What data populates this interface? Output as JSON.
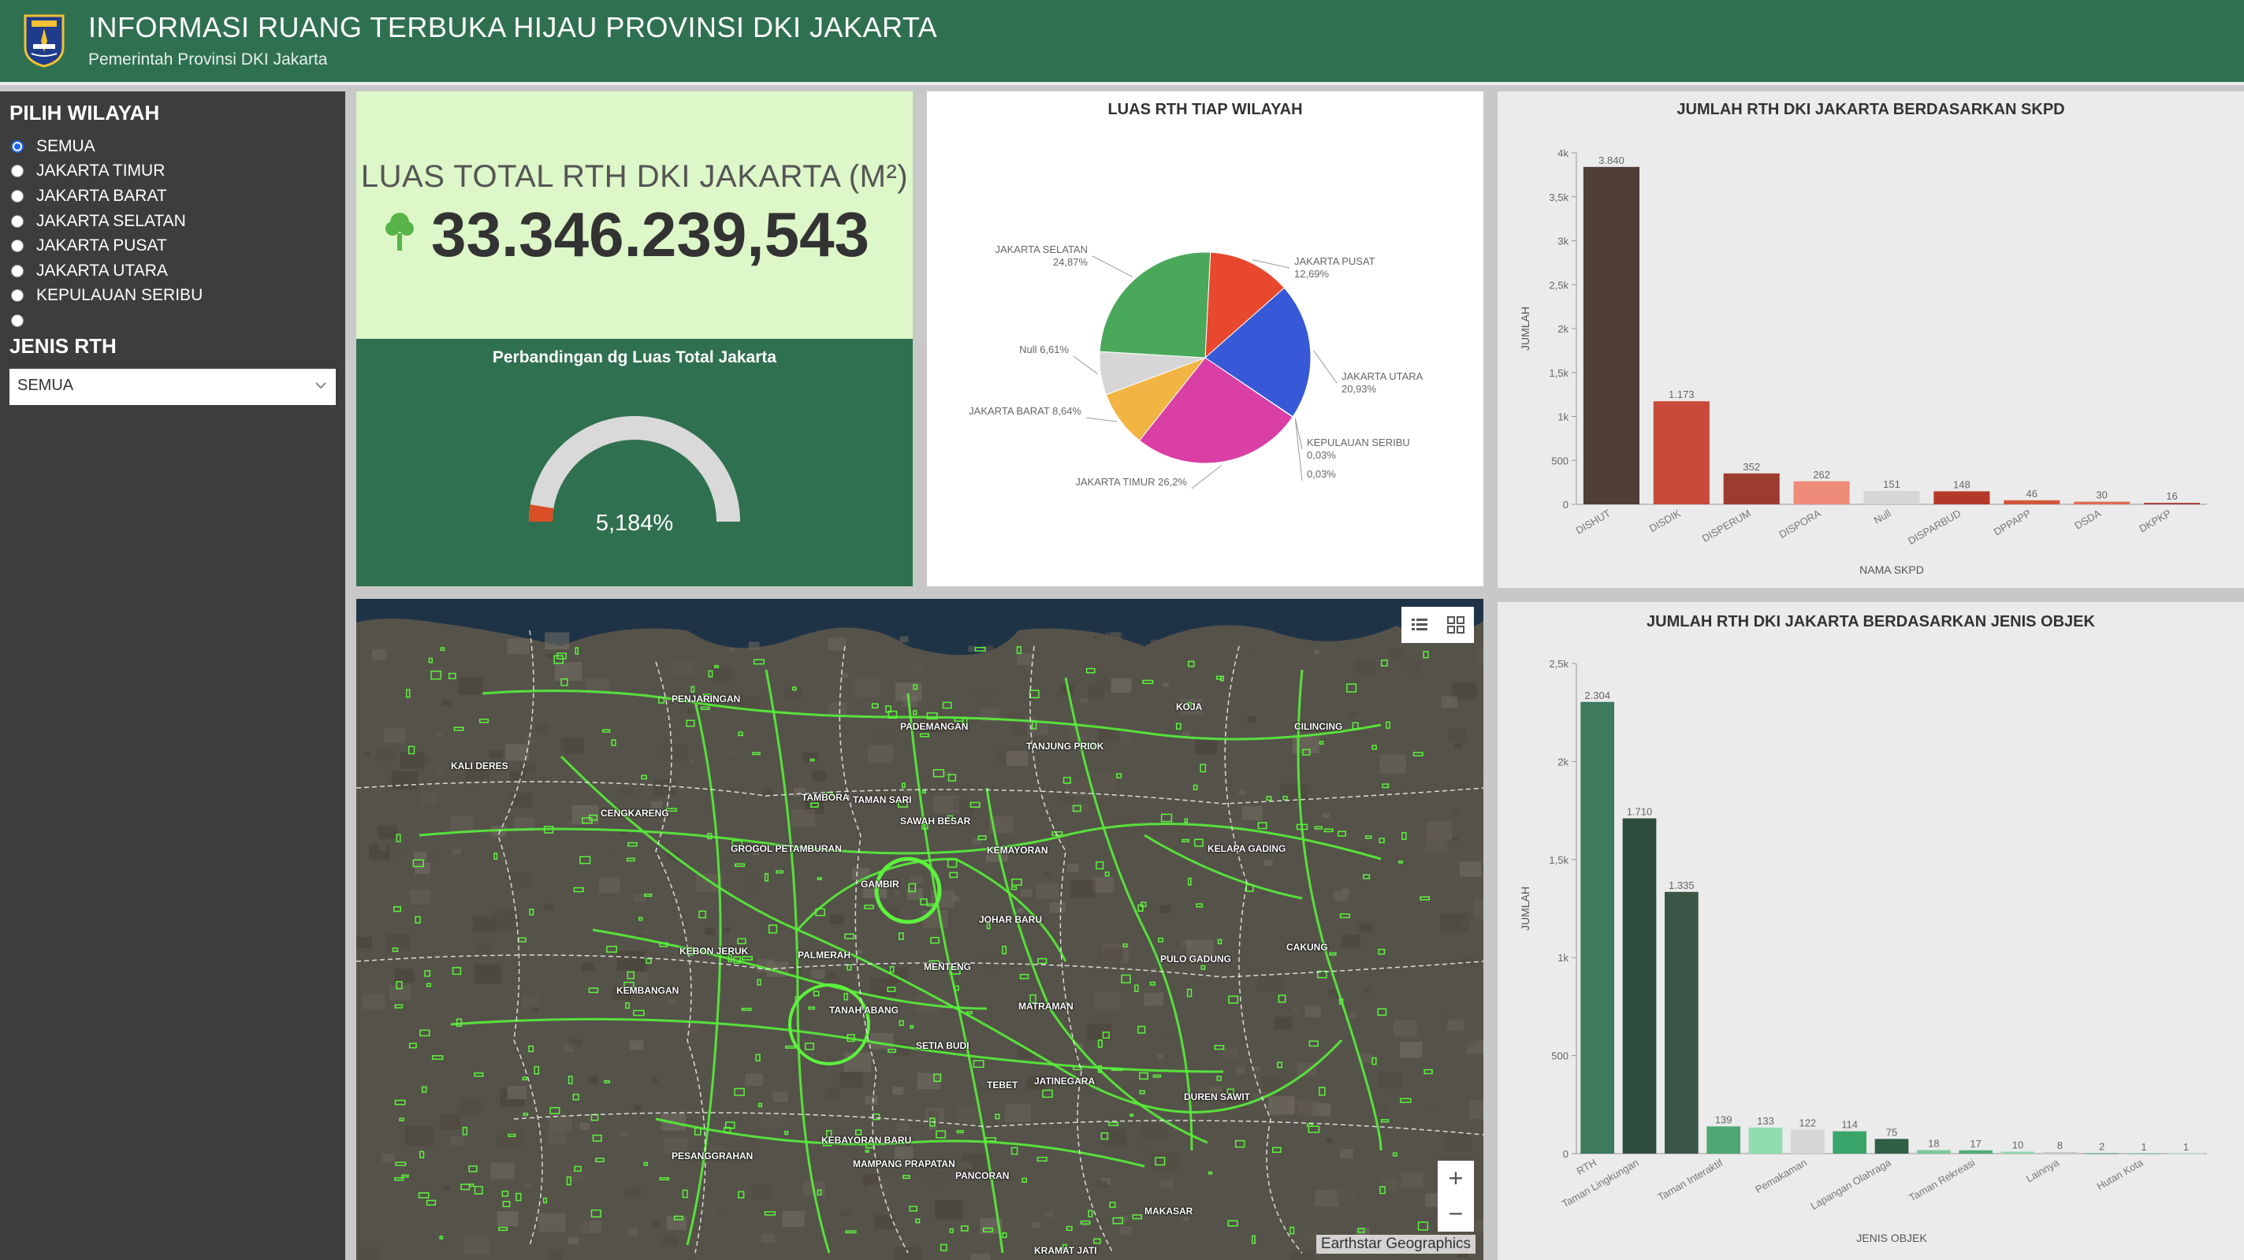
{
  "header": {
    "title": "INFORMASI RUANG TERBUKA HIJAU PROVINSI DKI JAKARTA",
    "subtitle": "Pemerintah Provinsi DKI Jakarta",
    "logo_icon": "jakarta-crest-icon"
  },
  "sidebar": {
    "wilayah_title": "PILIH WILAYAH",
    "wilayah_options": [
      "SEMUA",
      "JAKARTA TIMUR",
      "JAKARTA BARAT",
      "JAKARTA SELATAN",
      "JAKARTA PUSAT",
      "JAKARTA UTARA",
      "KEPULAUAN SERIBU",
      ""
    ],
    "wilayah_selected": "SEMUA",
    "jenis_title": "JENIS RTH",
    "jenis_value": "SEMUA"
  },
  "total": {
    "label": "LUAS TOTAL RTH DKI JAKARTA (M²)",
    "value": "33.346.239,543",
    "icon": "tree-icon"
  },
  "gauge": {
    "title": "Perbandingan dg Luas Total Jakarta",
    "value_label": "5,184%",
    "value": 0.05184,
    "colors": {
      "track": "#d9d9d9",
      "fill": "#d94e25"
    }
  },
  "map": {
    "attribution": "Earthstar Geographics",
    "zoom_in": "+",
    "zoom_out": "−",
    "labels": [
      "PENJARINGAN",
      "PADEMANGAN",
      "TANJUNG PRIOK",
      "KOJA",
      "CILINCING",
      "KALI DERES",
      "CENGKARENG",
      "TAMBORA",
      "TAMAN SARI",
      "SAWAH BESAR",
      "GROGOL PETAMBURAN",
      "KELAPA GADING",
      "KEMAYORAN",
      "GAMBIR",
      "JOHAR BARU",
      "KEBON JERUK",
      "PALMERAH",
      "MENTENG",
      "PULO GADUNG",
      "CAKUNG",
      "KEMBANGAN",
      "TANAH ABANG",
      "MATRAMAN",
      "SETIA BUDI",
      "TEBET",
      "JATINEGARA",
      "DUREN SAWIT",
      "KEBAYORAN BARU",
      "PESANGGRAHAN",
      "MAMPANG PRAPATAN",
      "PANCORAN",
      "MAKASAR",
      "KRAMAT JATI"
    ]
  },
  "chart_data": [
    {
      "type": "pie",
      "title": "LUAS RTH TIAP WILAYAH",
      "slices": [
        {
          "label": "JAKARTA PUSAT",
          "value": 12.69,
          "text": "12,69%",
          "color": "#e8482d"
        },
        {
          "label": "JAKARTA UTARA",
          "value": 20.93,
          "text": "20,93%",
          "color": "#3759d7"
        },
        {
          "label": "KEPULAUAN SERIBU",
          "value": 0.03,
          "text": "0,03%",
          "color": "#6aa6d9"
        },
        {
          "label": "",
          "value": 0.03,
          "text": "0,03%",
          "color": "#8fd0e0"
        },
        {
          "label": "JAKARTA TIMUR",
          "value": 26.2,
          "text": "26,2%",
          "color": "#d93fa4"
        },
        {
          "label": "JAKARTA BARAT",
          "value": 8.64,
          "text": "8,64%",
          "color": "#f2b544"
        },
        {
          "label": "Null",
          "value": 6.61,
          "text": "6,61%",
          "color": "#d6d6d6"
        },
        {
          "label": "JAKARTA SELATAN",
          "value": 24.87,
          "text": "24,87%",
          "color": "#4aa85a"
        }
      ]
    },
    {
      "type": "bar",
      "title": "JUMLAH RTH DKI JAKARTA BERDASARKAN SKPD",
      "xlabel": "NAMA SKPD",
      "ylabel": "JUMLAH",
      "ylim": [
        0,
        4000
      ],
      "yticks": [
        "0",
        "500",
        "1k",
        "1,5k",
        "2k",
        "2,5k",
        "3k",
        "3,5k",
        "4k"
      ],
      "categories": [
        "DISHUT",
        "DISDIK",
        "DISPERUM",
        "DISPORA",
        "Null",
        "DISPARBUD",
        "DPPAPP",
        "DSDA",
        "DKPKP"
      ],
      "values": [
        3840,
        1173,
        352,
        262,
        151,
        148,
        46,
        30,
        16
      ],
      "value_labels": [
        "3.840",
        "1.173",
        "352",
        "262",
        "151",
        "148",
        "46",
        "30",
        "16"
      ],
      "colors": [
        "#4f3f37",
        "#c84a3b",
        "#9e3b2f",
        "#ee8c79",
        "#d6d6d6",
        "#b5392a",
        "#d4563c",
        "#e06b52",
        "#a7342a"
      ]
    },
    {
      "type": "bar",
      "title": "JUMLAH RTH DKI JAKARTA BERDASARKAN JENIS OBJEK",
      "xlabel": "JENIS OBJEK",
      "ylabel": "JUMLAH",
      "ylim": [
        0,
        2500
      ],
      "yticks": [
        "0",
        "500",
        "1k",
        "1,5k",
        "2k",
        "2,5k"
      ],
      "categories": [
        "RTH",
        "Taman Lingkungan",
        "",
        "Taman Interaktif",
        "",
        "Pemakaman",
        "",
        "Lapangan Olahraga",
        "",
        "Taman Rekreasi",
        "",
        "Lainnya",
        "",
        "Hutan Kota",
        ""
      ],
      "values": [
        2304,
        1710,
        1335,
        139,
        133,
        122,
        114,
        75,
        18,
        17,
        10,
        8,
        2,
        1,
        1
      ],
      "value_labels": [
        "2.304",
        "1.710",
        "1.335",
        "139",
        "133",
        "122",
        "114",
        "75",
        "18",
        "17",
        "10",
        "8",
        "2",
        "1",
        "1"
      ],
      "colors": [
        "#3d7a5e",
        "#2f4d3f",
        "#3a5546",
        "#4ea874",
        "#8fdcb0",
        "#d6d6d6",
        "#3aa56a",
        "#2f5f46",
        "#7dc99d",
        "#4fae78",
        "#8ed9b0",
        "#c9c9c9",
        "#3c8d61",
        "#6bbd8d",
        "#a3dfbc"
      ],
      "label_every": 2
    }
  ]
}
